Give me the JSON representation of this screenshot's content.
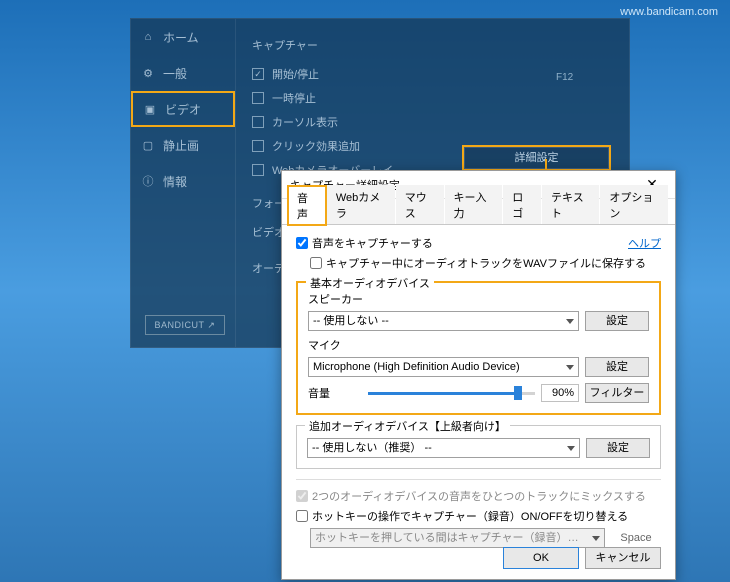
{
  "watermark": "www.bandicam.com",
  "sidebar": {
    "items": [
      {
        "icon": "⌂",
        "label": "ホーム",
        "name": "sidebar-item-home"
      },
      {
        "icon": "⚙",
        "label": "一般",
        "name": "sidebar-item-general"
      },
      {
        "icon": "▣",
        "label": "ビデオ",
        "name": "sidebar-item-video"
      },
      {
        "icon": "▢",
        "label": "静止画",
        "name": "sidebar-item-screenshot"
      },
      {
        "icon": "ⓘ",
        "label": "情報",
        "name": "sidebar-item-info"
      }
    ],
    "highlight_index": 2,
    "bandicut": "BANDICUT ↗"
  },
  "capture": {
    "section": "キャプチャー",
    "items": [
      {
        "label": "開始/停止",
        "checked": true,
        "hotkey": "F12"
      },
      {
        "label": "一時停止",
        "checked": false
      },
      {
        "label": "カーソル表示",
        "checked": false
      },
      {
        "label": "クリック効果追加",
        "checked": false
      },
      {
        "label": "Webカメラオーバーレイ",
        "checked": false
      }
    ],
    "advanced_btn": "詳細設定",
    "format_section": "フォーマット",
    "video_label": "ビデオ",
    "audio_label": "オーディオ"
  },
  "dialog": {
    "title": "キャプチャー詳細設定",
    "tabs": [
      "音声",
      "Webカメラ",
      "マウス",
      "キー入力",
      "ロゴ",
      "テキスト",
      "オプション"
    ],
    "active_tab": 0,
    "help": "ヘルプ",
    "capture_audio": {
      "label": "音声をキャプチャーする",
      "checked": true
    },
    "save_wav": {
      "label": "キャプチャー中にオーディオトラックをWAVファイルに保存する",
      "checked": false
    },
    "basic": {
      "legend": "基本オーディオデバイス",
      "speaker_label": "スピーカー",
      "speaker_value": "-- 使用しない --",
      "speaker_btn": "設定",
      "mic_label": "マイク",
      "mic_value": "Microphone (High Definition Audio Device)",
      "mic_btn": "設定",
      "volume_label": "音量",
      "volume_value": "90%",
      "filter_btn": "フィルター"
    },
    "additional": {
      "legend": "追加オーディオデバイス【上級者向け】",
      "value": "-- 使用しない（推奨） --",
      "btn": "設定"
    },
    "mix_two": {
      "label": "2つのオーディオデバイスの音声をひとつのトラックにミックスする",
      "checked": true
    },
    "hotkey_toggle": {
      "label": "ホットキーの操作でキャプチャー（録音）ON/OFFを切り替える",
      "checked": false
    },
    "hotkey_mode": {
      "value": "ホットキーを押している間はキャプチャー（録音）する",
      "key": "Space"
    },
    "ok": "OK",
    "cancel": "キャンセル"
  }
}
